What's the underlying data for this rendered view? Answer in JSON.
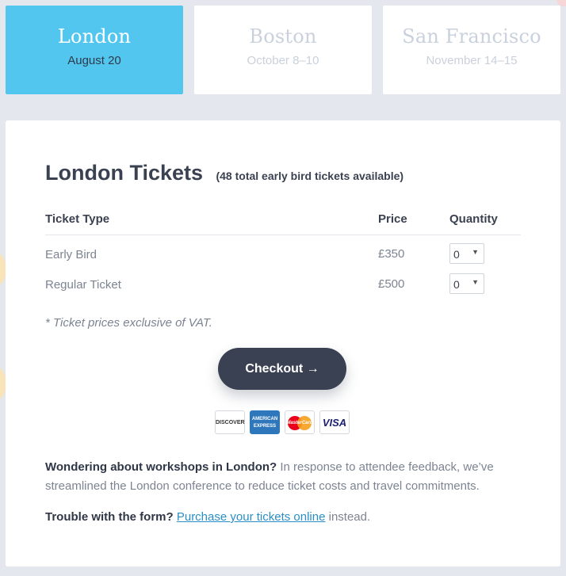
{
  "cities": [
    {
      "name": "London",
      "date": "August 20",
      "active": true
    },
    {
      "name": "Boston",
      "date": "October 8–10",
      "active": false
    },
    {
      "name": "San Francisco",
      "date": "November 14–15",
      "active": false
    }
  ],
  "tickets": {
    "title": "London Tickets",
    "subtitle": "(48 total early bird tickets available)",
    "columns": {
      "type": "Ticket Type",
      "price": "Price",
      "quantity": "Quantity"
    },
    "rows": [
      {
        "type": "Early Bird",
        "price": "£350",
        "quantity": "0"
      },
      {
        "type": "Regular Ticket",
        "price": "£500",
        "quantity": "0"
      }
    ],
    "note": "* Ticket prices exclusive of VAT."
  },
  "checkout": {
    "label": "Checkout →"
  },
  "payment_icons": [
    "DISCOVER",
    "AMERICAN EXPRESS",
    "MasterCard",
    "VISA"
  ],
  "info": {
    "workshops_bold": "Wondering about workshops in London?",
    "workshops_text": " In response to attendee feedback, we’ve streamlined the London conference to reduce ticket costs and travel commitments.",
    "trouble_bold": "Trouble with the form?",
    "trouble_link": "Purchase your tickets online",
    "trouble_after": " instead."
  },
  "colors": {
    "active_tab": "#52c6ef",
    "button": "#394152",
    "link": "#2a8fc7"
  }
}
